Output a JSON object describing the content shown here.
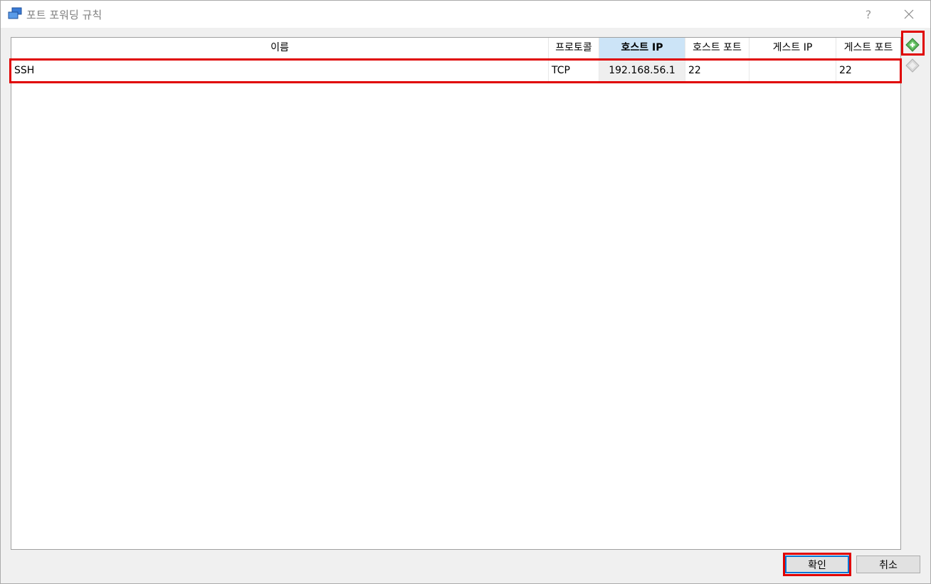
{
  "window": {
    "title": "포트 포워딩 규칙",
    "help_label": "?",
    "close_label": "✕"
  },
  "table": {
    "columns": [
      {
        "key": "name",
        "label": "이름"
      },
      {
        "key": "protocol",
        "label": "프로토콜"
      },
      {
        "key": "host_ip",
        "label": "호스트 IP",
        "sorted": true
      },
      {
        "key": "host_port",
        "label": "호스트 포트"
      },
      {
        "key": "guest_ip",
        "label": "게스트 IP"
      },
      {
        "key": "guest_port",
        "label": "게스트 포트"
      }
    ],
    "rows": [
      {
        "name": "SSH",
        "protocol": "TCP",
        "host_ip": "192.168.56.1",
        "host_port": "22",
        "guest_ip": "",
        "guest_port": "22"
      }
    ]
  },
  "side_buttons": {
    "add_icon": "add-rule-icon",
    "remove_icon": "remove-rule-icon"
  },
  "footer": {
    "ok_label": "확인",
    "cancel_label": "취소"
  },
  "colors": {
    "highlight": "#e00000",
    "sorted_header": "#cce4f7",
    "focus_border": "#0078d7"
  }
}
